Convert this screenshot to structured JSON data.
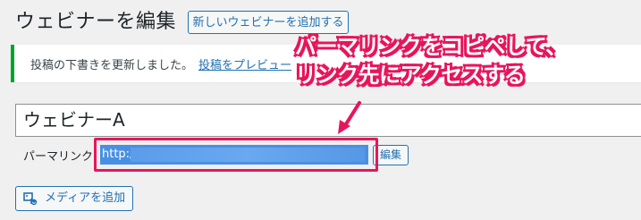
{
  "header": {
    "title": "ウェビナーを編集",
    "add_new_label": "新しいウェビナーを追加する"
  },
  "notice": {
    "message": "投稿の下書きを更新しました。",
    "link_label": "投稿をプレビュー"
  },
  "editor": {
    "post_title": "ウェビナーA",
    "permalink_label": "パーマリンク:",
    "permalink_url": "http://",
    "edit_label": "編集",
    "add_media_label": "メディアを追加"
  },
  "annotation": {
    "line1": "パーマリンクをコピペして、",
    "line2": "リンク先にアクセスする",
    "color": "#e8155a"
  },
  "colors": {
    "accent": "#2271b1",
    "notice_success": "#00a32a",
    "annotation": "#e8155a",
    "selection": "#4a90e2"
  }
}
